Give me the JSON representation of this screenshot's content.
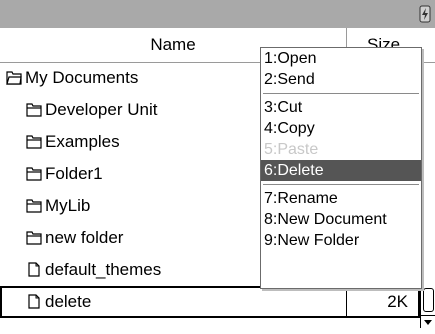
{
  "columns": {
    "name": "Name",
    "size": "Size"
  },
  "rows": [
    {
      "label": "My Documents",
      "kind": "folder-open",
      "size": ""
    },
    {
      "label": "Developer Unit",
      "kind": "folder",
      "size": ""
    },
    {
      "label": "Examples",
      "kind": "folder",
      "size": ""
    },
    {
      "label": "Folder1",
      "kind": "folder",
      "size": ""
    },
    {
      "label": "MyLib",
      "kind": "folder",
      "size": ""
    },
    {
      "label": "new folder",
      "kind": "folder",
      "size": ""
    },
    {
      "label": "default_themes",
      "kind": "document",
      "size": ""
    },
    {
      "label": "delete",
      "kind": "document",
      "size": "2K"
    }
  ],
  "context_menu": {
    "items": [
      {
        "label": "1:Open"
      },
      {
        "label": "2:Send"
      },
      {
        "label": "3:Cut"
      },
      {
        "label": "4:Copy"
      },
      {
        "label": "5:Paste"
      },
      {
        "label": "6:Delete"
      },
      {
        "label": "7:Rename"
      },
      {
        "label": "8:New Document"
      },
      {
        "label": "9:New Folder"
      }
    ]
  },
  "colors": {
    "titlebar": "#a9a9a9",
    "menu_highlight": "#555555",
    "disabled_text": "#c8c8c8"
  },
  "icons": {
    "title": "battery-status-icon",
    "folder": "folder-icon",
    "folder_open": "open-folder-icon",
    "document": "document-icon"
  }
}
